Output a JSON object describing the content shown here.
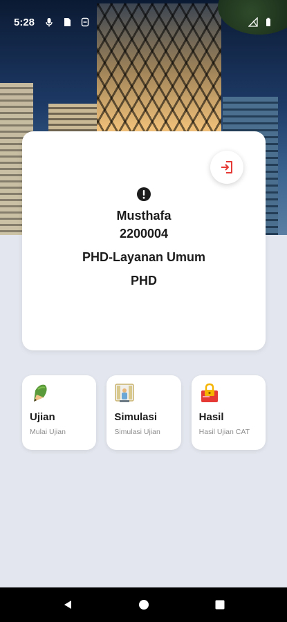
{
  "status_bar": {
    "time": "5:28",
    "left_icons": [
      "mic-icon",
      "sim-card-icon",
      "vpn-shield-icon"
    ],
    "right_icons": [
      "signal-icon",
      "battery-icon"
    ]
  },
  "profile": {
    "name": "Musthafa",
    "id": "2200004",
    "unit": "PHD-Layanan Umum",
    "code": "PHD",
    "logout_icon": "logout-icon",
    "alert_icon": "alert-circle-icon"
  },
  "menu": [
    {
      "title": "Ujian",
      "subtitle": "Mulai Ujian",
      "icon": "pencil-icon"
    },
    {
      "title": "Simulasi",
      "subtitle": "Simulasi Ujian",
      "icon": "simulation-icon"
    },
    {
      "title": "Hasil",
      "subtitle": "Hasil Ujian CAT",
      "icon": "locked-card-icon"
    }
  ],
  "nav": [
    "back-icon",
    "home-icon",
    "recents-icon"
  ],
  "colors": {
    "accent_red": "#e53935",
    "background": "#e3e6ee",
    "card": "#ffffff"
  }
}
